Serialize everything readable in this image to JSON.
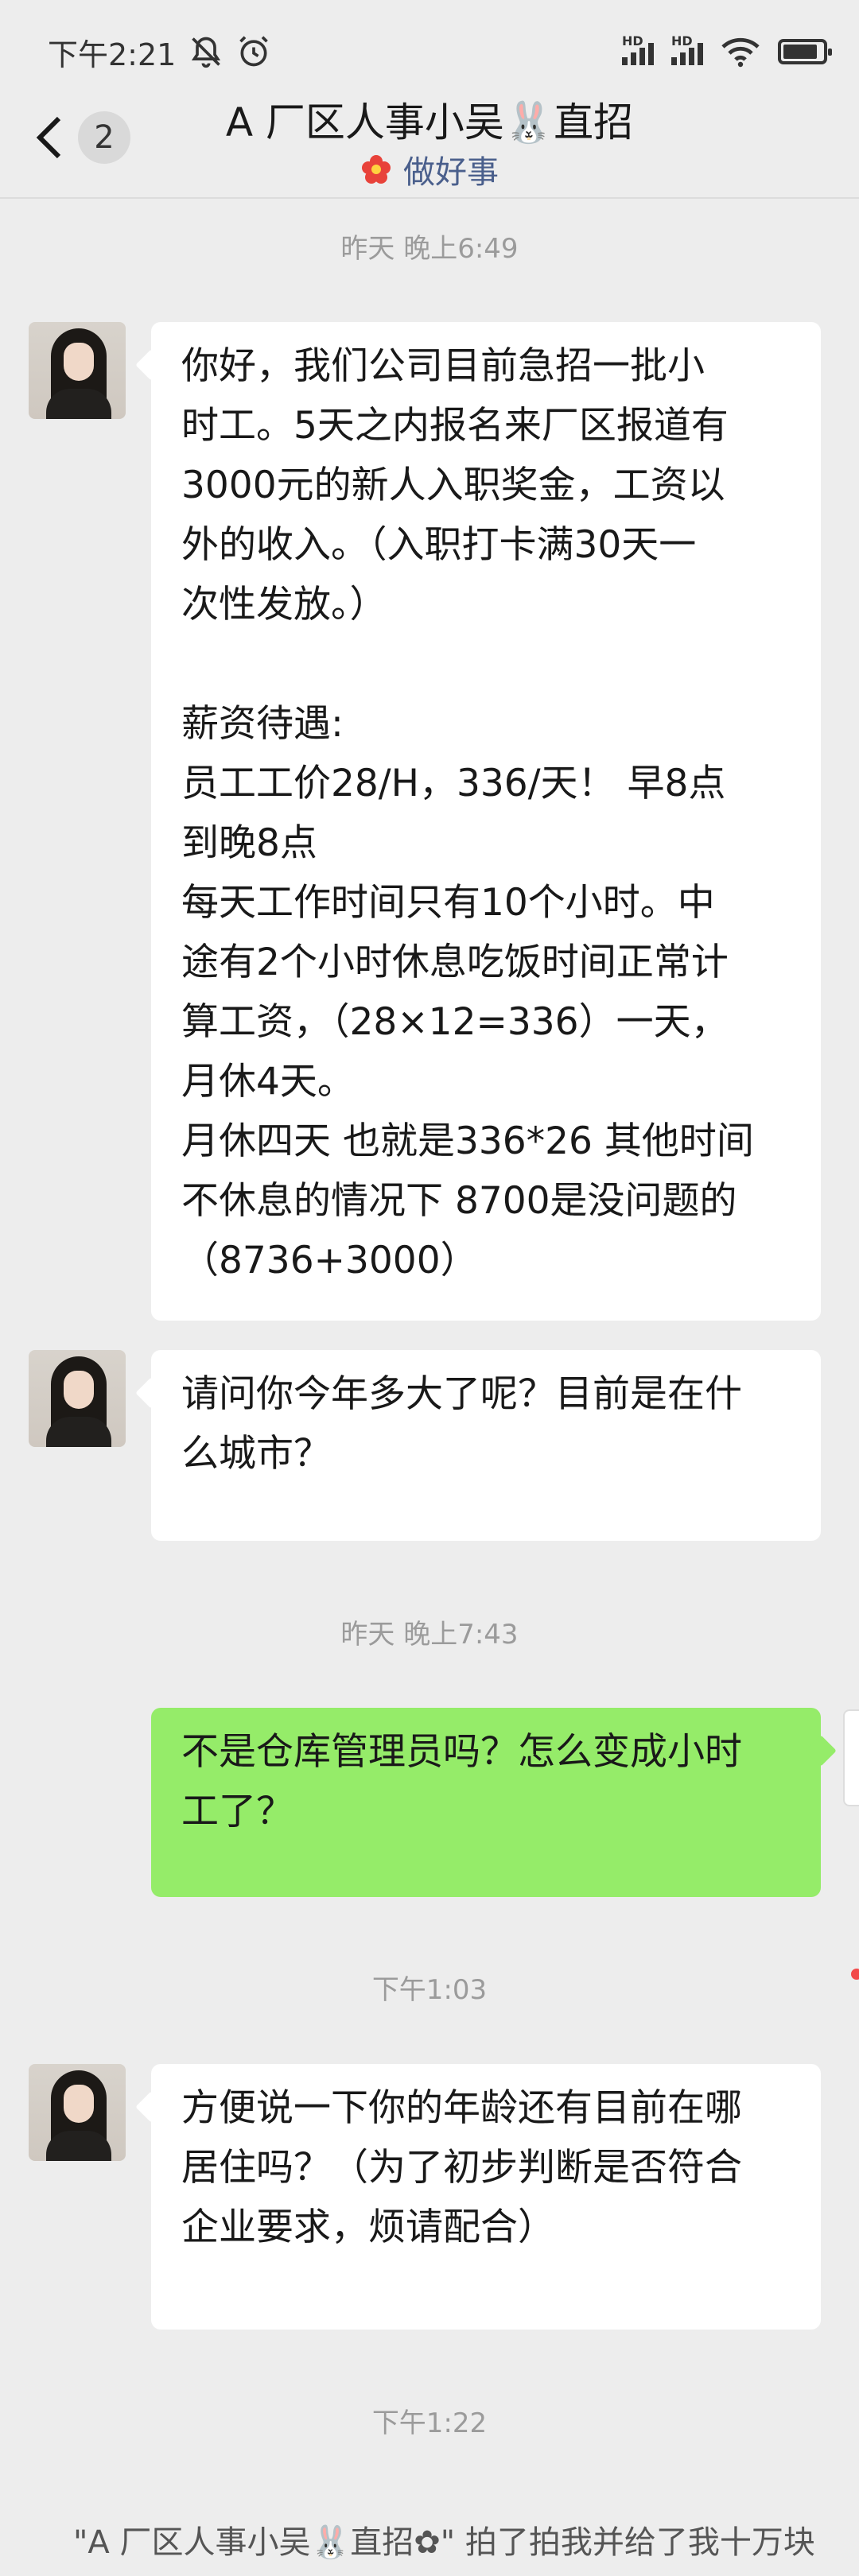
{
  "status_bar": {
    "time": "下午2:21",
    "signal_label": "HD"
  },
  "header": {
    "back_count": "2",
    "title": "A 厂区人事小吴🐰直招",
    "subtitle": "做好事"
  },
  "messages": {
    "ts1": "昨天 晚上6:49",
    "msg1": "你好，我们公司目前急招一批小\n时工。5天之内报名来厂区报道有\n3000元的新人入职奖金，工资以\n外的收入。（入职打卡满30天一\n次性发放。）\n\n薪资待遇:\n员工工价28/H，336/天！ 早8点\n到晚8点\n每天工作时间只有10个小时。中\n途有2个小时休息吃饭时间正常计\n算工资，（28×12=336）一天，\n月休4天。\n月休四天 也就是336*26 其他时间\n不休息的情况下 8700是没问题的\n（8736+3000）",
    "msg2": "请问你今年多大了呢？目前是在什\n么城市？",
    "ts2": "昨天 晚上7:43",
    "msg3": "不是仓库管理员吗？怎么变成小时\n工了？",
    "ts3": "下午1:03",
    "msg4": "方便说一下你的年龄还有目前在哪\n居住吗？（为了初步判断是否符合\n企业要求，烦请配合）",
    "ts4": "下午1:22",
    "pat": "\"A 厂区人事小吴🐰直招✿\" 拍了拍我并给了我十万块"
  },
  "colors": {
    "background": "#ededed",
    "sent_bubble": "#95ec69",
    "received_bubble": "#ffffff",
    "subtitle_blue": "#4a5f8c",
    "flower_red": "#e8423a"
  },
  "icons": [
    "mute-bell-icon",
    "alarm-clock-icon",
    "signal-icon",
    "wifi-icon",
    "battery-icon",
    "back-arrow-icon",
    "flower-icon"
  ]
}
